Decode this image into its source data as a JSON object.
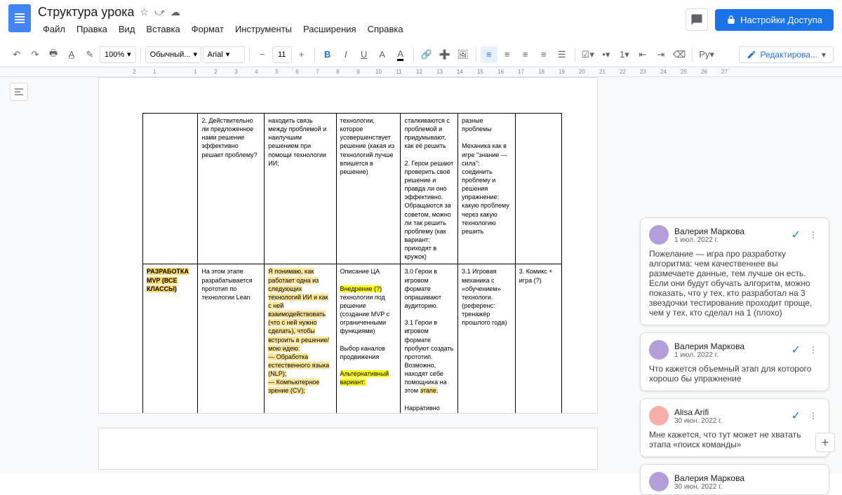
{
  "title": "Структура урока",
  "menus": [
    "Файл",
    "Правка",
    "Вид",
    "Вставка",
    "Формат",
    "Инструменты",
    "Расширения",
    "Справка"
  ],
  "share": "Настройки Доступа",
  "toolbar": {
    "zoom": "100%",
    "style": "Обычный...",
    "font": "Arial",
    "size": "11",
    "editMode": "Редактирова..."
  },
  "ruler": [
    "2",
    "1",
    "",
    "1",
    "2",
    "3",
    "4",
    "5",
    "6",
    "7",
    "8",
    "9",
    "10",
    "11",
    "12",
    "13",
    "14",
    "15",
    "16",
    "17",
    "18",
    "19",
    "20",
    "21",
    "22",
    "23",
    "24",
    "25",
    "26",
    "27"
  ],
  "table": {
    "r1": {
      "c1": "2. Действительно ли предложенное нами решение эффективно решает проблему?",
      "c2": "находить связь между проблемой и наилучшим решением при помощи технологии ИИ;",
      "c3": "технологии, которое усовершенствует решение (какая из технологий лучше впишется в решение)",
      "c4": "сталкиваются с проблемой и придумывают, как её решить\n\n2. Герои решают проверить своё решение и правда ли оно эффективно. Обращаются за советом, можно ли так решить проблему (как вариант: приходят в кружок)",
      "c5": "разные проблемы\n\nМеханика как в игре \"знание — сила\": соединить проблему и решения упражнение: какую проблему через какую технологию решить"
    },
    "r2": {
      "c0a": "РАЗРАБОТКА MVP (ВСЕ КЛАССЫ)",
      "c1": "На этом этапе разрабатывается прототип по технологии Lean",
      "c2a": "Я понимаю, как работает одна из следующих технологий ИИ и как с ней взаимодействовать (что с ней нужно сделать), чтобы встроить в решение/мою идею:",
      "c2b": "— Обработка естественного языка (NLP);",
      "c2c": "— Компьютерное зрение (CV);",
      "c3a": "Описание ЦА",
      "c3b": "Внедрение (?)",
      "c3c": " технологии под решение (создание MVP с ограниченными функциями)",
      "c3d": "Выбор каналов продвижения",
      "c3e": "Альтернативный вариант:",
      "c4a": "3.0 Герои в игровом формате опрашивают аудиторию.",
      "c4b": "3.1 Герои в игровом формате пробуют создать прототип. Возможно, находят себе помощника на этом ",
      "c4c": "этапе.",
      "c4d": "Нарративно подсвечиваем,",
      "c5": "3.1 Игровая механика с «обучением» технологи. (референс: тренажёр прошлого года)",
      "c6": "3. Комикс + игра (?)"
    }
  },
  "comments": [
    {
      "name": "Валерия Маркова",
      "date": "1 июл. 2022 г.",
      "text": "Пожелание — игра про разработку алгоритма: чем качественнее вы размечаете данные, тем лучше он есть. Если они будут обучать алгоритм, можно показать, что у тех, кто разработал на 3 звездочки тестирование проходит проще, чем у тех, кто сделал на 1 (плохо)"
    },
    {
      "name": "Валерия Маркова",
      "date": "1 июл. 2022 г.",
      "text": "Что кажется объемный этап для которого хорошо бы упражнение"
    },
    {
      "name": "Alisa Arifi",
      "date": "30 июн. 2022 г.",
      "text": "Мне кажется, что тут может не хватать этапа «поиск команды»"
    },
    {
      "name": "Валерия Маркова",
      "date": "30 июн. 2022 г.",
      "text": ""
    }
  ]
}
